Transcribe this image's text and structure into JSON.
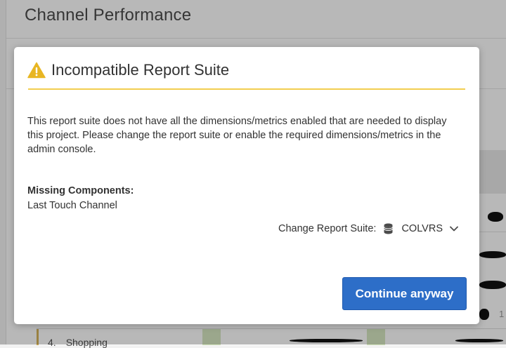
{
  "background": {
    "panel_title": "Channel Performance",
    "bottom_row": {
      "index": "4.",
      "label": "Shopping"
    },
    "partial_value": "1"
  },
  "dialog": {
    "title": "Incompatible Report Suite",
    "warning_icon": "alert-triangle-icon",
    "message": "This report suite does not have all the dimensions/metrics enabled that are needed to display this project. Please change the report suite or enable the required dimensions/metrics in the admin console.",
    "missing_heading": "Missing Components:",
    "missing_items": [
      "Last Touch Channel"
    ],
    "change_suite_label": "Change Report Suite:",
    "suite_icon": "database-icon",
    "suite_value": "COLVRS",
    "continue_label": "Continue anyway"
  },
  "colors": {
    "accent_blue": "#2d6ec8",
    "warning_yellow": "#f2ce50",
    "overlay": "rgba(0,0,0,0.28)"
  }
}
